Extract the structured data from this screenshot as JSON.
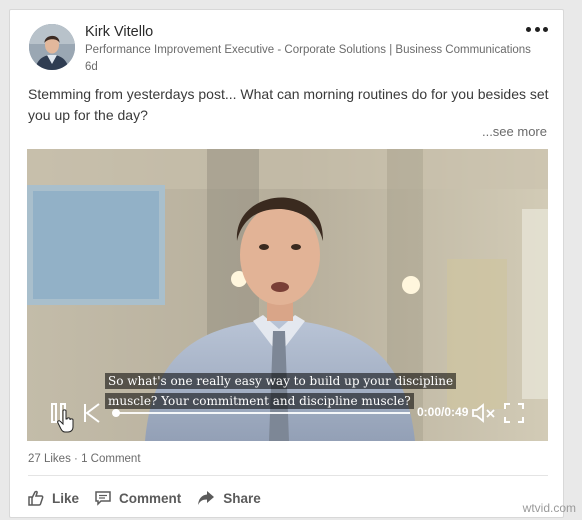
{
  "post": {
    "author_name": "Kirk Vitello",
    "author_headline": "Performance Improvement Executive - Corporate Solutions | Business Communications",
    "post_age": "6d",
    "text": "Stemming from yesterdays post... What can morning routines do for you besides set you up for the day?",
    "see_more": "...see more"
  },
  "video": {
    "caption_line1": "So what's one really easy way to build up your discipline",
    "caption_line2": "muscle? Your commitment and discipline muscle?",
    "time": "0:00/0:49",
    "progress": 0.0
  },
  "social": {
    "likes": "27 Likes",
    "separator": " · ",
    "comments": "1 Comment"
  },
  "actions": {
    "like": "Like",
    "comment": "Comment",
    "share": "Share"
  },
  "watermark": "wtvid.com",
  "colors": {
    "card_bg": "#ffffff",
    "page_bg": "#e9e9e9",
    "text_primary": "#2a2a2a",
    "text_secondary": "#6b6b6b"
  }
}
